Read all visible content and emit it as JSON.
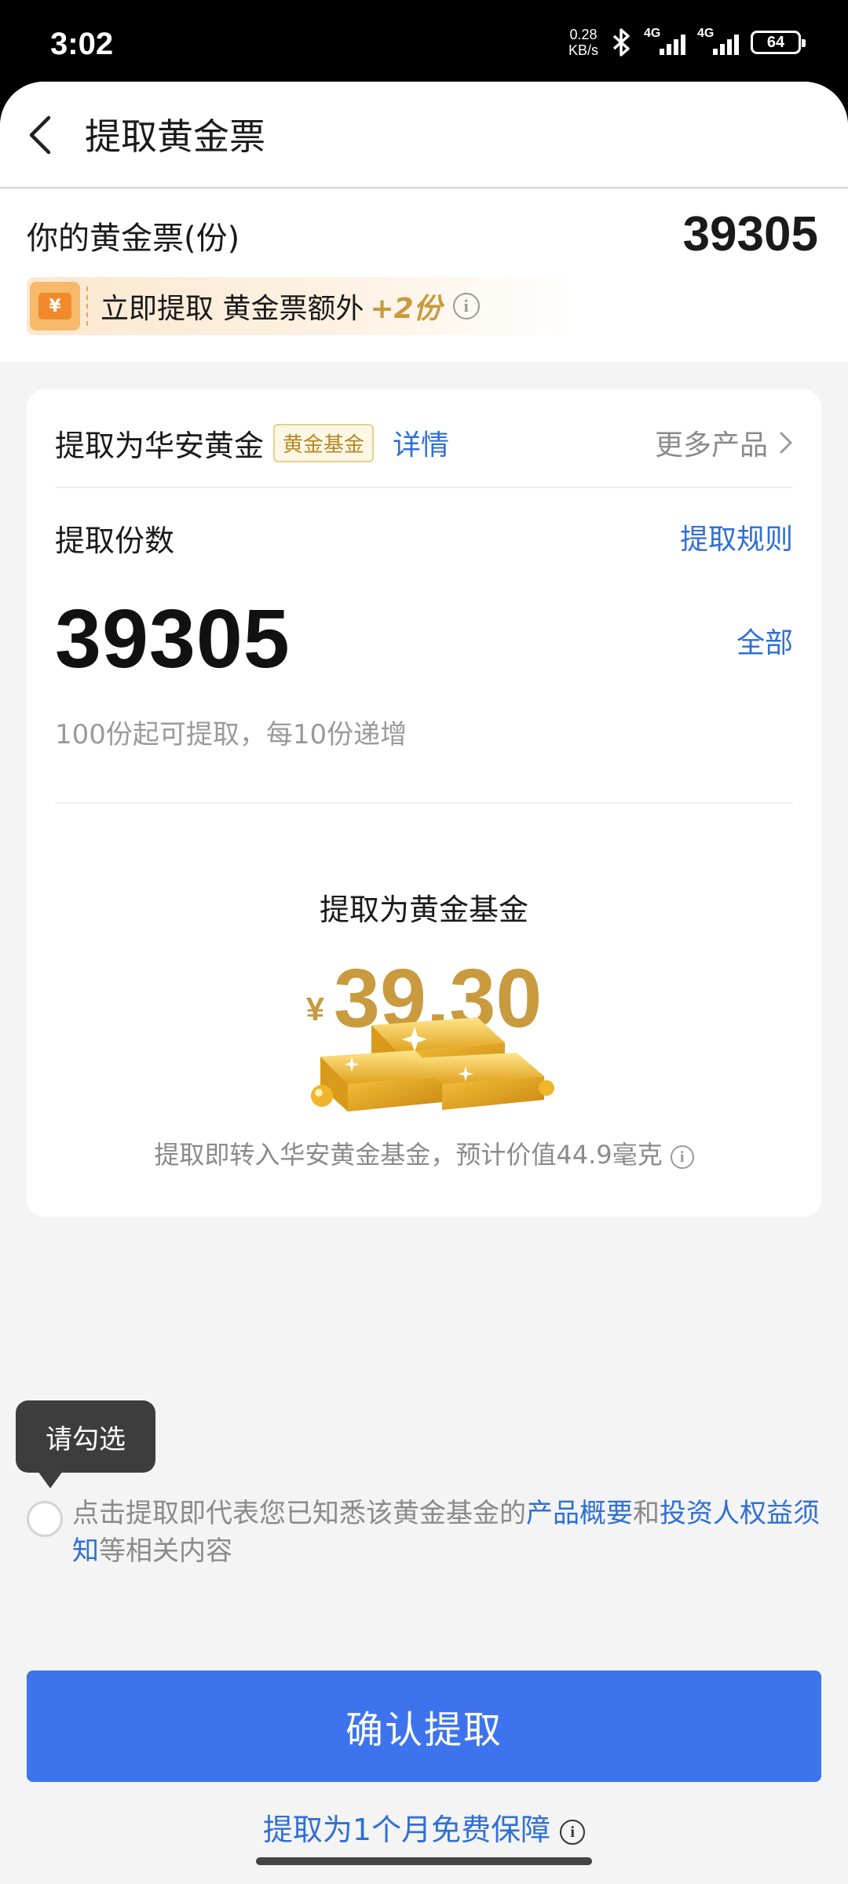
{
  "status_bar": {
    "time": "3:02",
    "net_speed_value": "0.28",
    "net_speed_unit": "KB/s",
    "sim1": "4G",
    "sim2": "4G",
    "battery": "64"
  },
  "header": {
    "title": "提取黄金票"
  },
  "ticket": {
    "label": "你的黄金票(份)",
    "count": "39305",
    "promo_text": "立即提取 黄金票额外",
    "promo_bonus": "+2份",
    "promo_icon_glyph": "¥"
  },
  "card": {
    "product_name": "提取为华安黄金",
    "product_tag": "黄金基金",
    "detail_link": "详情",
    "more_products": "更多产品",
    "amount_label": "提取份数",
    "rules_link": "提取规则",
    "amount": "39305",
    "all_link": "全部",
    "hint": "100份起可提取，每10份递增",
    "to_fund": "提取为黄金基金",
    "currency": "¥",
    "value": "39.30",
    "estimate": "提取即转入华安黄金基金，预计价值44.9毫克"
  },
  "tooltip": {
    "text": "请勾选"
  },
  "agreement": {
    "prefix": "点击提取即代表您已知悉该黄金基金的",
    "link1": "产品概要",
    "and": "和",
    "link2": "投资人权益须知",
    "suffix": "等相关内容",
    "checked": false
  },
  "actions": {
    "confirm": "确认提取",
    "protection": "提取为1个月免费保障"
  },
  "colors": {
    "primary_blue": "#3d74ee",
    "link_blue": "#2f6fd6",
    "gold": "#c99a3e"
  },
  "icons": {
    "back": "chevron-left-icon",
    "chevron": "chevron-right-icon",
    "info": "info-icon",
    "gold_bars": "gold-bars-illustration"
  }
}
